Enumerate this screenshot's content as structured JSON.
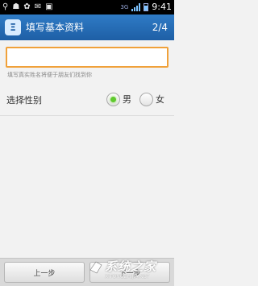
{
  "status_bar": {
    "left_icons": [
      "usb-icon",
      "android-debug-icon",
      "notification-icon",
      "mail-icon",
      "sd-card-icon"
    ],
    "network_label": "3G",
    "time": "9:41"
  },
  "title_bar": {
    "logo_char": "Ξ",
    "title": "填写基本资料",
    "step": "2/4"
  },
  "name_field": {
    "value": "",
    "placeholder": "",
    "hint": "填写真实姓名将便于朋友们找到你"
  },
  "gender": {
    "label": "选择性别",
    "options": [
      {
        "label": "男",
        "selected": true
      },
      {
        "label": "女",
        "selected": false
      }
    ]
  },
  "bottom": {
    "prev_label": "上一步",
    "next_label": "下一步"
  },
  "watermark": {
    "text": "系统之家",
    "url": "XITONGZHIJIA.NET"
  },
  "colors": {
    "title_bar": "#1e5fa6",
    "input_border": "#f0a13a",
    "radio_selected": "#5fc92e"
  }
}
